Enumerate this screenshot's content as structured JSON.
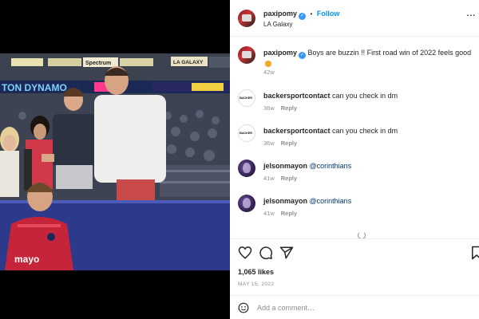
{
  "post_header": {
    "username": "paxipomy",
    "follow_label": "Follow",
    "separator": "•",
    "location": "LA Galaxy",
    "more_label": "..."
  },
  "photo": {
    "signs": [
      "Spectrum",
      "LA GALAXY",
      "TON DYNAMO"
    ],
    "jersey_text": "mayo"
  },
  "caption": {
    "username": "paxipomy",
    "text": "Boys are buzzin !! First road win of 2022 feels good",
    "time": "42w"
  },
  "comments": [
    {
      "username": "backersportcontact",
      "text": "can you check in dm",
      "time": "36w",
      "reply_label": "Reply",
      "avatar": "backer-logo"
    },
    {
      "username": "backersportcontact",
      "text": "can you check in dm",
      "time": "36w",
      "reply_label": "Reply",
      "avatar": "backer-logo"
    },
    {
      "username": "jelsonmayon",
      "text": "@corinthians",
      "time": "41w",
      "reply_label": "Reply",
      "avatar": "jel-avatar"
    },
    {
      "username": "jelsonmayon",
      "text": "@corinthians",
      "time": "41w",
      "reply_label": "Reply",
      "avatar": "jel-avatar"
    }
  ],
  "actions": {
    "icons": [
      "heart-icon",
      "comment-icon",
      "share-icon",
      "bookmark-icon"
    ],
    "likes": "1,065 likes",
    "date": "MAY 15, 2022"
  },
  "comment_box": {
    "placeholder": "Add a comment…"
  },
  "colors": {
    "accent": "#0095f6",
    "verified": "#3897f0",
    "muted": "#8e8e8e"
  }
}
